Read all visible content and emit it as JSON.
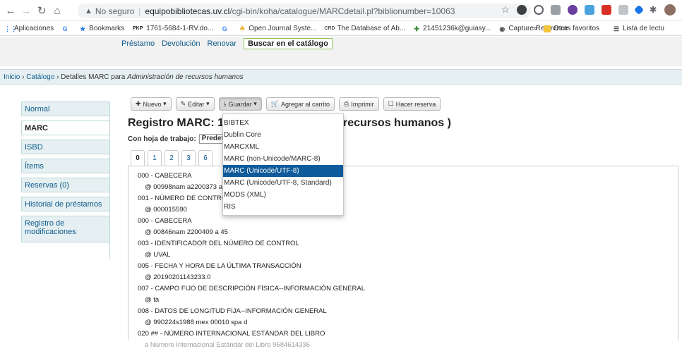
{
  "browser": {
    "not_secure": "No seguro",
    "host": "equipobibliotecas.uv.cl",
    "path": "/cgi-bin/koha/catalogue/MARCdetail.pl?biblionumber=10063",
    "bookmarks": [
      "Aplicaciones",
      "Bookmarks",
      "1761-5684-1-RV.do...",
      "Open Journal Syste...",
      "The Database of Ab...",
      "21451236k@guiasy...",
      "Capture Reference"
    ],
    "other_bookmarks": "Otros favoritos",
    "reading_list": "Lista de lectu"
  },
  "koha_nav": {
    "prestamo": "Préstamo",
    "devolucion": "Devolución",
    "renovar": "Renovar",
    "buscar": "Buscar en el catálogo"
  },
  "breadcrumb": {
    "inicio": "Inicio",
    "catalogo": "Catálogo",
    "detalles_prefix": "Detalles MARC para",
    "title": "Administración de recursos humanos"
  },
  "sidebar": [
    "Normal",
    "MARC",
    "ISBD",
    "Ítems",
    "Reservas (0)",
    "Historial de préstamos",
    "Registro de modificaciones"
  ],
  "toolbar": {
    "nuevo": "Nuevo",
    "editar": "Editar",
    "guardar": "Guardar",
    "carrito": "Agregar al carrito",
    "imprimir": "Imprimir",
    "reserva": "Hacer reserva"
  },
  "record": {
    "title_left": "Registro MARC: 10",
    "title_right": "recursos humanos )",
    "worksheet_label": "Con hoja de trabajo:",
    "worksheet_value": "Predeter"
  },
  "tabs": [
    "0",
    "1",
    "2",
    "3",
    "6"
  ],
  "dropdown": {
    "items": [
      "BIBTEX",
      "Dublin Core",
      "MARCXML",
      "MARC (non-Unicode/MARC-8)",
      "MARC (Unicode/UTF-8)",
      "MARC (Unicode/UTF-8, Standard)",
      "MODS (XML)",
      "RIS"
    ],
    "highlighted_index": 4
  },
  "marc_lines": [
    "000 - CABECERA",
    "@ 00998nam a2200373 a 4",
    "001 - NÚMERO DE CONTRO",
    "@ 000015590",
    "000 - CABECERA",
    "@ 00846nam 2200409 a 45",
    "003 - IDENTIFICADOR DEL NÚMERO DE CONTROL",
    "@ UVAL",
    "005 - FECHA Y HORA DE LA ÚLTIMA TRANSACCIÓN",
    "@ 20190201143233.0",
    "007 - CAMPO FIJO DE DESCRIPCIÓN FÍSICA--INFORMACIÓN GENERAL",
    "@ ta",
    "008 - DATOS DE LONGITUD FIJA--INFORMACIÓN GENERAL",
    "@ 990224s1988 mex 00010 spa d",
    "020 ## - NÚMERO INTERNACIONAL ESTÁNDAR DEL LIBRO",
    "a Número Internacional Estándar del Libro 9684614336"
  ]
}
